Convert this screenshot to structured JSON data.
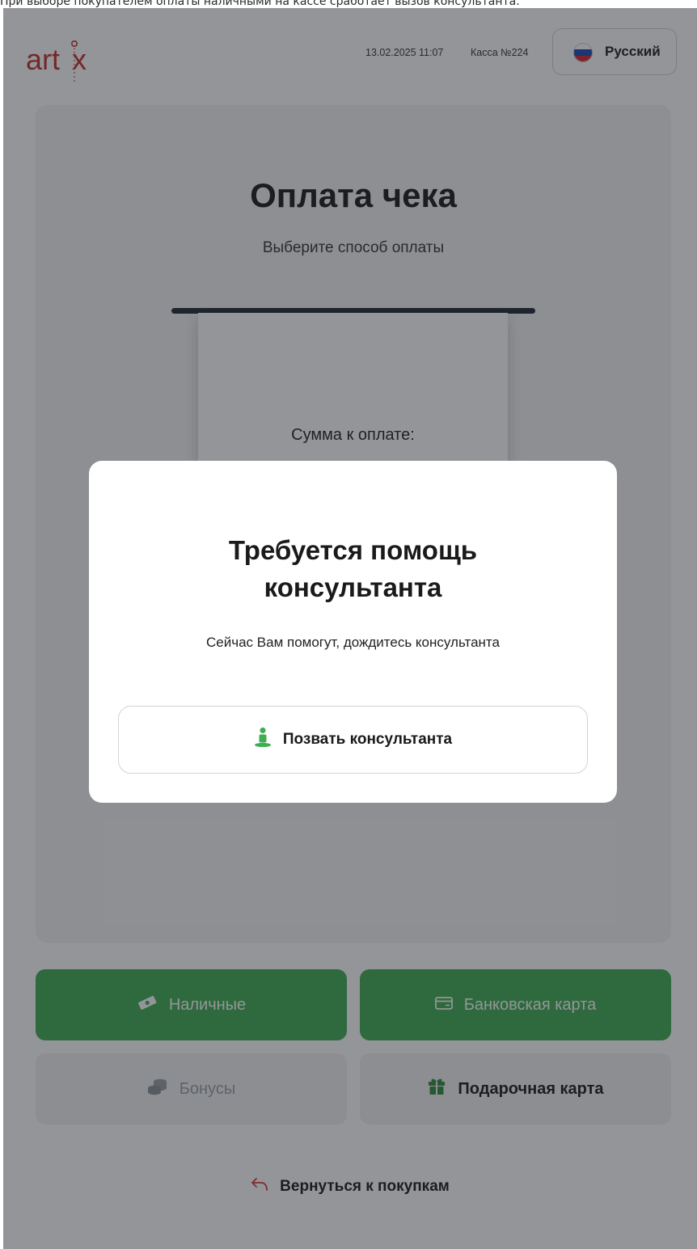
{
  "caption": "При выборе покупателем оплаты наличными на кассе сработает вызов консультанта.",
  "header": {
    "logo_text": "artix",
    "datetime": "13.02.2025 11:07",
    "register": "Касса №224",
    "language_label": "Русский"
  },
  "payment": {
    "title": "Оплата чека",
    "subtitle": "Выберите способ оплаты",
    "amount_label": "Сумма к оплате:",
    "methods": {
      "cash": "Наличные",
      "bank_card": "Банковская карта",
      "bonuses": "Бонусы",
      "gift_card": "Подарочная карта"
    },
    "back_label": "Вернуться к покупкам"
  },
  "modal": {
    "title_line1": "Требуется помощь",
    "title_line2": "консультанта",
    "text": "Сейчас Вам помогут, дождитесь консультанта",
    "call_button": "Позвать консультанта"
  },
  "colors": {
    "accent_green": "#3fad52",
    "logo_red": "#c0312f",
    "overlay": "#1e2228"
  },
  "icons": {
    "language": "russian-flag-icon",
    "cash": "banknote-icon",
    "bank_card": "credit-card-icon",
    "bonuses": "coins-stack-icon",
    "gift_card": "gift-icon",
    "back": "back-arrow-icon",
    "call": "consultant-person-icon"
  }
}
